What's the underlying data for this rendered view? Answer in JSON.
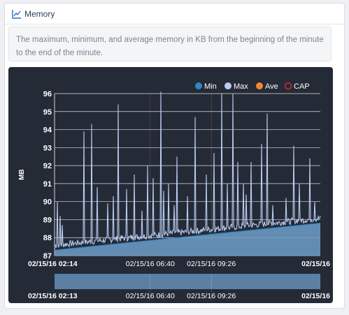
{
  "header": {
    "title": "Memory",
    "icon": "line-chart-icon"
  },
  "description": "The maximum, minimum, and average memory in KB from the beginning of the minute to the end of the minute.",
  "colors": {
    "min": "#2f86c7",
    "max": "#b8cdf0",
    "ave": "#f08a2c",
    "cap": "#d12a2a",
    "background": "#252a37",
    "area": "#6f9ec8"
  },
  "chart_data": {
    "type": "line",
    "ylabel": "MB",
    "ylim": [
      87,
      96
    ],
    "y_ticks": [
      "87",
      "88",
      "89",
      "90",
      "91",
      "92",
      "93",
      "94",
      "95",
      "96"
    ],
    "x_ticks": [
      "02/15/16 02:14",
      "02/15/16 06:40",
      "02/15/16 09:26",
      "02/15/16"
    ],
    "navigator_ticks": [
      "02/15/16 02:13",
      "02/15/16 06:40",
      "02/15/16 09:26",
      "02/15/16"
    ],
    "legend": [
      "Min",
      "Max",
      "Ave",
      "CAP"
    ],
    "legend_position": "top-right",
    "grid": true,
    "series": [
      {
        "name": "Min",
        "x_start": "02/15/16 02:14",
        "y_start": 87.3,
        "y_end": 88.8
      },
      {
        "name": "Max",
        "baseline_start": 87.5,
        "baseline_end": 89.0,
        "spike_fraction": [
          0.01,
          0.02,
          0.03,
          0.11,
          0.14,
          0.16,
          0.2,
          0.22,
          0.24,
          0.27,
          0.3,
          0.33,
          0.35,
          0.37,
          0.4,
          0.41,
          0.43,
          0.45,
          0.46,
          0.5,
          0.53,
          0.57,
          0.6,
          0.63,
          0.65,
          0.67,
          0.69,
          0.71,
          0.72,
          0.74,
          0.78,
          0.8,
          0.82,
          0.87,
          0.9,
          0.92,
          0.96,
          0.98
        ],
        "spike_values": [
          90.0,
          89.2,
          88.7,
          93.9,
          94.3,
          90.8,
          89.9,
          90.3,
          95.4,
          90.7,
          91.5,
          89.5,
          92.0,
          91.3,
          96.1,
          90.6,
          91.0,
          89.8,
          92.5,
          90.3,
          94.7,
          91.5,
          92.7,
          96.0,
          91.0,
          96.0,
          92.2,
          91.0,
          90.4,
          92.2,
          93.2,
          94.9,
          89.8,
          90.2,
          93.1,
          91.0,
          92.4,
          90.0
        ]
      },
      {
        "name": "Ave"
      },
      {
        "name": "CAP"
      }
    ]
  }
}
